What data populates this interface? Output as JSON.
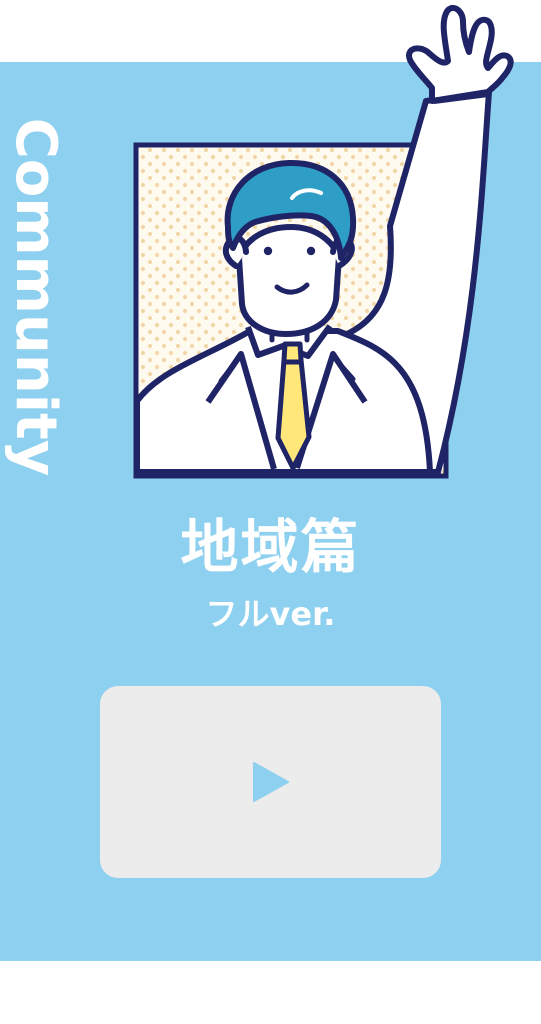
{
  "side_label": "Community",
  "title": "地域篇",
  "subtitle": "フルver.",
  "video": {
    "play_icon": "play-icon"
  },
  "colors": {
    "panel": "#8ed0ef",
    "video_card": "#ececec",
    "play": "#8ed0ef",
    "hair": "#2e9ec6",
    "outline": "#1f2466",
    "tie": "#ffe77a",
    "dots": "#f1d6a6"
  }
}
